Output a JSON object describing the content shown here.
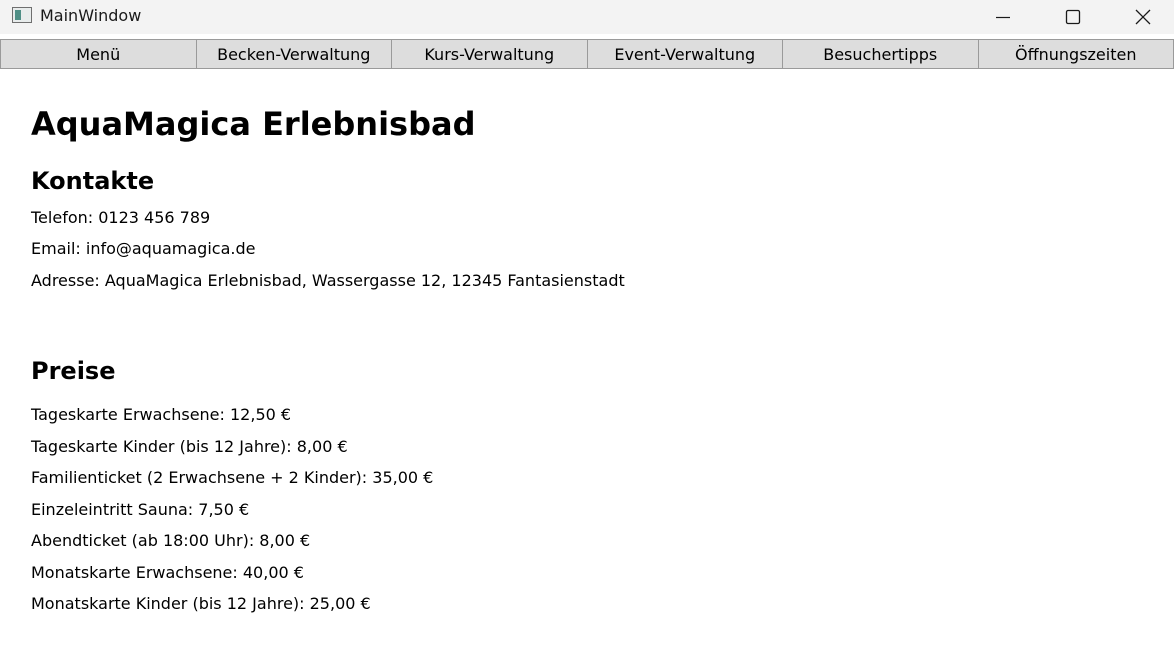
{
  "window": {
    "title": "MainWindow"
  },
  "tabs": [
    {
      "label": "Menü"
    },
    {
      "label": "Becken-Verwaltung"
    },
    {
      "label": "Kurs-Verwaltung"
    },
    {
      "label": "Event-Verwaltung"
    },
    {
      "label": "Besuchertipps"
    },
    {
      "label": "Öffnungszeiten"
    }
  ],
  "page": {
    "title": "AquaMagica Erlebnisbad"
  },
  "contacts": {
    "heading": "Kontakte",
    "phone": "Telefon: 0123 456 789",
    "email": "Email: info@aquamagica.de",
    "address": "Adresse: AquaMagica Erlebnisbad, Wassergasse 12, 12345 Fantasienstadt"
  },
  "prices": {
    "heading": "Preise",
    "items": [
      "Tageskarte Erwachsene: 12,50 €",
      "Tageskarte Kinder (bis 12 Jahre): 8,00 €",
      "Familienticket (2 Erwachsene + 2 Kinder): 35,00 €",
      "Einzeleintritt Sauna: 7,50 €",
      "Abendticket (ab 18:00 Uhr): 8,00 €",
      "Monatskarte Erwachsene: 40,00 €",
      "Monatskarte Kinder (bis 12 Jahre): 25,00 €"
    ]
  },
  "icons": {
    "app": "window-app-icon",
    "minimize": "minimize-icon",
    "maximize": "maximize-icon",
    "close": "close-icon"
  }
}
